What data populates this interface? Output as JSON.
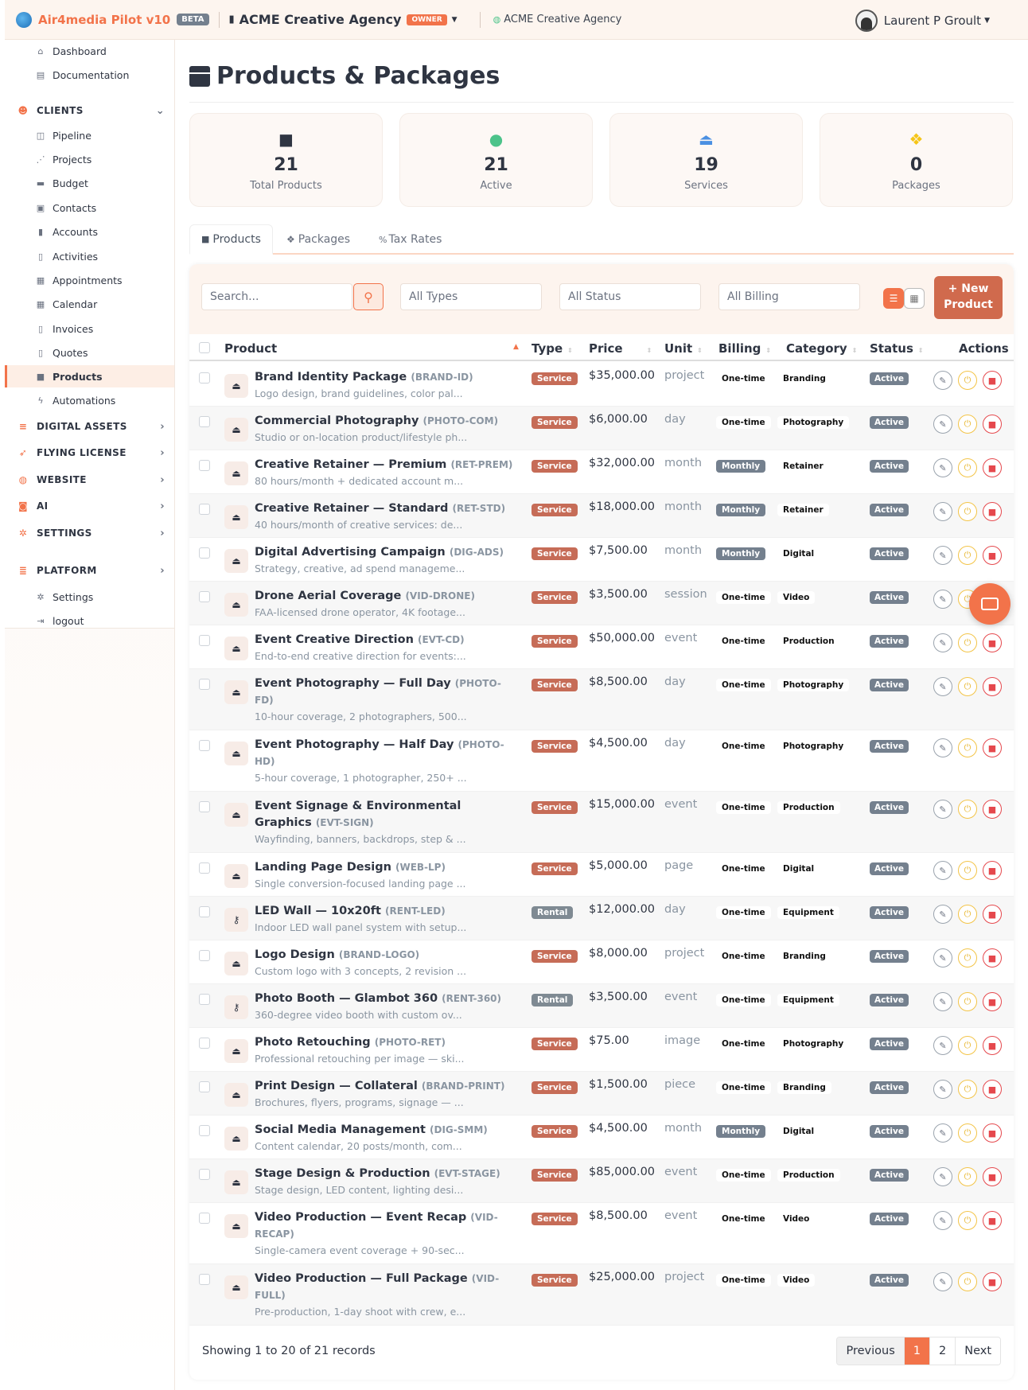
{
  "header": {
    "app_name": "Air4media Pilot v10",
    "beta": "BETA",
    "org": "ACME Creative Agency",
    "role": "OWNER",
    "org_link": "ACME Creative Agency",
    "user": "Laurent P Groult"
  },
  "sidebar": {
    "dashboard": "Dashboard",
    "documentation": "Documentation",
    "clients": "CLIENTS",
    "pipeline": "Pipeline",
    "projects": "Projects",
    "budget": "Budget",
    "contacts": "Contacts",
    "accounts": "Accounts",
    "activities": "Activities",
    "appointments": "Appointments",
    "calendar": "Calendar",
    "invoices": "Invoices",
    "quotes": "Quotes",
    "products": "Products",
    "automations": "Automations",
    "digital_assets": "DIGITAL ASSETS",
    "flying_license": "FLYING LICENSE",
    "website": "WEBSITE",
    "ai": "AI",
    "settings": "SETTINGS",
    "platform": "PLATFORM",
    "platform_settings": "Settings",
    "logout": "logout"
  },
  "page": {
    "title": "Products & Packages"
  },
  "stats": [
    {
      "value": "21",
      "label": "Total Products",
      "icon": "box-icon",
      "color": "#2f3542"
    },
    {
      "value": "21",
      "label": "Active",
      "icon": "check-circle-icon",
      "color": "#4cc38a"
    },
    {
      "value": "19",
      "label": "Services",
      "icon": "bell-service-icon",
      "color": "#4a90e2"
    },
    {
      "value": "0",
      "label": "Packages",
      "icon": "cubes-icon",
      "color": "#f5c518"
    }
  ],
  "tabs": {
    "products": "Products",
    "packages": "Packages",
    "tax_rates": "Tax Rates"
  },
  "filters": {
    "search_placeholder": "Search...",
    "types": "All Types",
    "status": "All Status",
    "billing": "All Billing",
    "new_product_line1": "+ New",
    "new_product_line2": "Product"
  },
  "columns": {
    "product": "Product",
    "type": "Type",
    "price": "Price",
    "unit": "Unit",
    "billing": "Billing",
    "category": "Category",
    "status": "Status",
    "actions": "Actions"
  },
  "products": [
    {
      "name": "Brand Identity Package",
      "code": "(BRAND-ID)",
      "desc": "Logo design, brand guidelines, color pal...",
      "type": "Service",
      "price": "$35,000.00",
      "unit": "project",
      "billing": "One-time",
      "category": "Branding",
      "status": "Active"
    },
    {
      "name": "Commercial Photography",
      "code": "(PHOTO-COM)",
      "desc": "Studio or on-location product/lifestyle ph...",
      "type": "Service",
      "price": "$6,000.00",
      "unit": "day",
      "billing": "One-time",
      "category": "Photography",
      "status": "Active"
    },
    {
      "name": "Creative Retainer — Premium",
      "code": "(RET-PREM)",
      "desc": "80 hours/month + dedicated account m...",
      "type": "Service",
      "price": "$32,000.00",
      "unit": "month",
      "billing": "Monthly",
      "category": "Retainer",
      "status": "Active"
    },
    {
      "name": "Creative Retainer — Standard",
      "code": "(RET-STD)",
      "desc": "40 hours/month of creative services: de...",
      "type": "Service",
      "price": "$18,000.00",
      "unit": "month",
      "billing": "Monthly",
      "category": "Retainer",
      "status": "Active"
    },
    {
      "name": "Digital Advertising Campaign",
      "code": "(DIG-ADS)",
      "desc": "Strategy, creative, ad spend manageme...",
      "type": "Service",
      "price": "$7,500.00",
      "unit": "month",
      "billing": "Monthly",
      "category": "Digital",
      "status": "Active"
    },
    {
      "name": "Drone Aerial Coverage",
      "code": "(VID-DRONE)",
      "desc": "FAA-licensed drone operator, 4K footage...",
      "type": "Service",
      "price": "$3,500.00",
      "unit": "session",
      "billing": "One-time",
      "category": "Video",
      "status": "Active"
    },
    {
      "name": "Event Creative Direction",
      "code": "(EVT-CD)",
      "desc": "End-to-end creative direction for events:...",
      "type": "Service",
      "price": "$50,000.00",
      "unit": "event",
      "billing": "One-time",
      "category": "Production",
      "status": "Active"
    },
    {
      "name": "Event Photography — Full Day",
      "code": "(PHOTO-FD)",
      "desc": "10-hour coverage, 2 photographers, 500...",
      "type": "Service",
      "price": "$8,500.00",
      "unit": "day",
      "billing": "One-time",
      "category": "Photography",
      "status": "Active"
    },
    {
      "name": "Event Photography — Half Day",
      "code": "(PHOTO-HD)",
      "desc": "5-hour coverage, 1 photographer, 250+ ...",
      "type": "Service",
      "price": "$4,500.00",
      "unit": "day",
      "billing": "One-time",
      "category": "Photography",
      "status": "Active"
    },
    {
      "name": "Event Signage & Environmental Graphics",
      "code": "(EVT-SIGN)",
      "desc": "Wayfinding, banners, backdrops, step & ...",
      "type": "Service",
      "price": "$15,000.00",
      "unit": "event",
      "billing": "One-time",
      "category": "Production",
      "status": "Active"
    },
    {
      "name": "Landing Page Design",
      "code": "(WEB-LP)",
      "desc": "Single conversion-focused landing page ...",
      "type": "Service",
      "price": "$5,000.00",
      "unit": "page",
      "billing": "One-time",
      "category": "Digital",
      "status": "Active"
    },
    {
      "name": "LED Wall — 10x20ft",
      "code": "(RENT-LED)",
      "desc": "Indoor LED wall panel system with setup...",
      "type": "Rental",
      "price": "$12,000.00",
      "unit": "day",
      "billing": "One-time",
      "category": "Equipment",
      "status": "Active"
    },
    {
      "name": "Logo Design",
      "code": "(BRAND-LOGO)",
      "desc": "Custom logo with 3 concepts, 2 revision ...",
      "type": "Service",
      "price": "$8,000.00",
      "unit": "project",
      "billing": "One-time",
      "category": "Branding",
      "status": "Active"
    },
    {
      "name": "Photo Booth — Glambot 360",
      "code": "(RENT-360)",
      "desc": "360-degree video booth with custom ov...",
      "type": "Rental",
      "price": "$3,500.00",
      "unit": "event",
      "billing": "One-time",
      "category": "Equipment",
      "status": "Active"
    },
    {
      "name": "Photo Retouching",
      "code": "(PHOTO-RET)",
      "desc": "Professional retouching per image — ski...",
      "type": "Service",
      "price": "$75.00",
      "unit": "image",
      "billing": "One-time",
      "category": "Photography",
      "status": "Active"
    },
    {
      "name": "Print Design — Collateral",
      "code": "(BRAND-PRINT)",
      "desc": "Brochures, flyers, programs, signage — ...",
      "type": "Service",
      "price": "$1,500.00",
      "unit": "piece",
      "billing": "One-time",
      "category": "Branding",
      "status": "Active"
    },
    {
      "name": "Social Media Management",
      "code": "(DIG-SMM)",
      "desc": "Content calendar, 20 posts/month, com...",
      "type": "Service",
      "price": "$4,500.00",
      "unit": "month",
      "billing": "Monthly",
      "category": "Digital",
      "status": "Active"
    },
    {
      "name": "Stage Design & Production",
      "code": "(EVT-STAGE)",
      "desc": "Stage design, LED content, lighting desi...",
      "type": "Service",
      "price": "$85,000.00",
      "unit": "event",
      "billing": "One-time",
      "category": "Production",
      "status": "Active"
    },
    {
      "name": "Video Production — Event Recap",
      "code": "(VID-RECAP)",
      "desc": "Single-camera event coverage + 90-sec...",
      "type": "Service",
      "price": "$8,500.00",
      "unit": "event",
      "billing": "One-time",
      "category": "Video",
      "status": "Active"
    },
    {
      "name": "Video Production — Full Package",
      "code": "(VID-FULL)",
      "desc": "Pre-production, 1-day shoot with crew, e...",
      "type": "Service",
      "price": "$25,000.00",
      "unit": "project",
      "billing": "One-time",
      "category": "Video",
      "status": "Active"
    }
  ],
  "pagination": {
    "summary": "Showing 1 to 20 of 21 records",
    "previous": "Previous",
    "page1": "1",
    "page2": "2",
    "next": "Next"
  }
}
